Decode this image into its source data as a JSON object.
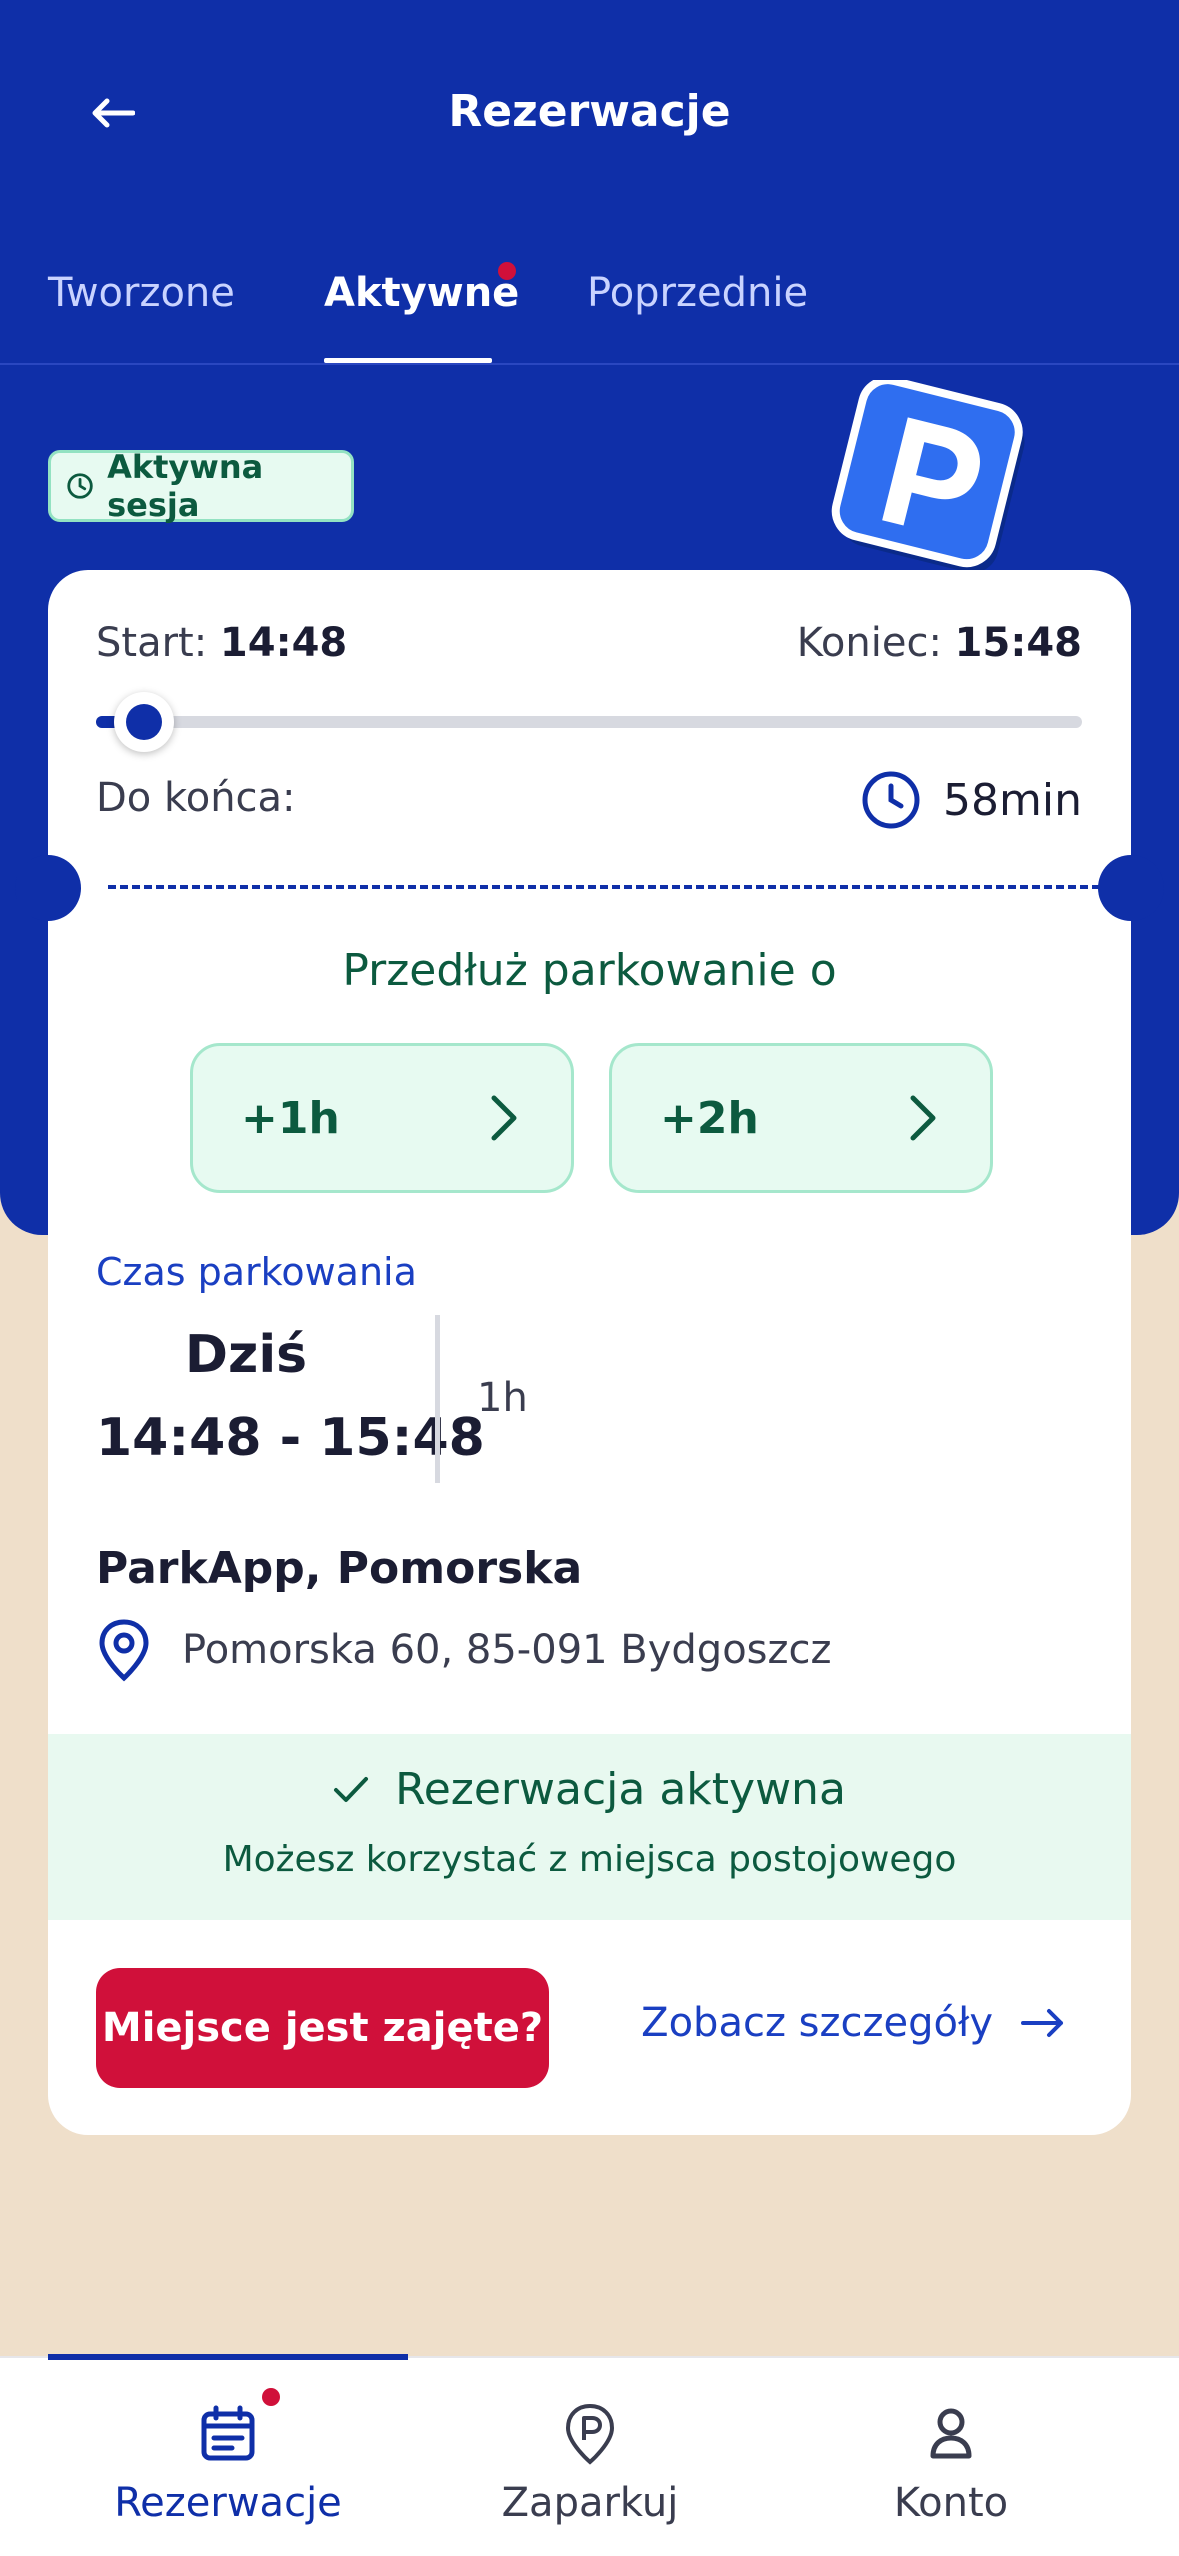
{
  "header": {
    "title": "Rezerwacje"
  },
  "tabs": [
    {
      "label": "Tworzone",
      "active": false
    },
    {
      "label": "Aktywne",
      "active": true,
      "has_notification_dot": true
    },
    {
      "label": "Poprzednie",
      "active": false
    }
  ],
  "session_badge": "Aktywna sesja",
  "timer": {
    "start_label": "Start:",
    "start_time": "14:48",
    "end_label": "Koniec:",
    "end_time": "15:48",
    "progress_fraction": 0.03,
    "remaining_label": "Do końca:",
    "remaining_value": "58min"
  },
  "extend": {
    "title": "Przedłuż parkowanie o",
    "options": [
      "+1h",
      "+2h"
    ]
  },
  "parking_time": {
    "label": "Czas parkowania",
    "day": "Dziś",
    "range": "14:48 - 15:48",
    "duration": "1h"
  },
  "location": {
    "name": "ParkApp, Pomorska",
    "address": "Pomorska 60, 85-091 Bydgoszcz"
  },
  "status_banner": {
    "title": "Rezerwacja aktywna",
    "subtitle": "Możesz korzystać z miejsca postojowego"
  },
  "actions": {
    "occupied_button": "Miejsce jest zajęte?",
    "details_link": "Zobacz szczegóły"
  },
  "bottom_nav": [
    {
      "label": "Rezerwacje",
      "icon": "calendar-icon",
      "active": true,
      "has_notification_dot": true
    },
    {
      "label": "Zaparkuj",
      "icon": "parking-pin-icon",
      "active": false
    },
    {
      "label": "Konto",
      "icon": "user-icon",
      "active": false
    }
  ],
  "colors": {
    "primary_blue": "#0f2fa8",
    "accent_red": "#d0103a",
    "success_green": "#0c5a3f",
    "success_bg": "#e7faf1",
    "page_bg": "#efdfca"
  }
}
